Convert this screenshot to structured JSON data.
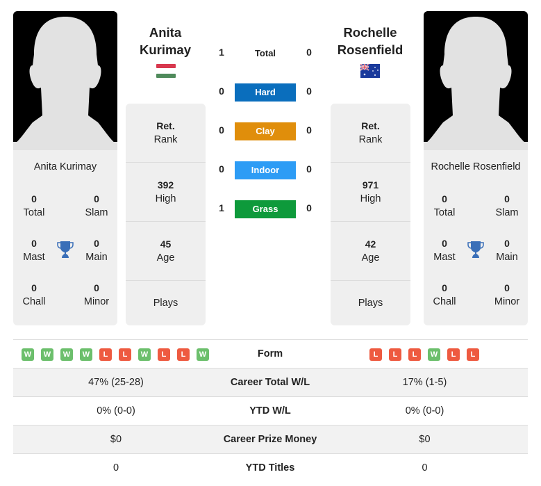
{
  "players": {
    "left": {
      "name_line1": "Anita",
      "name_line2": "Kurimay",
      "full_name": "Anita Kurimay",
      "country_flag": "hungary-flag",
      "titles": {
        "total": {
          "value": "0",
          "label": "Total"
        },
        "slam": {
          "value": "0",
          "label": "Slam"
        },
        "mast": {
          "value": "0",
          "label": "Mast"
        },
        "main": {
          "value": "0",
          "label": "Main"
        },
        "chall": {
          "value": "0",
          "label": "Chall"
        },
        "minor": {
          "value": "0",
          "label": "Minor"
        }
      },
      "rank": {
        "value": "Ret.",
        "label": "Rank"
      },
      "high": {
        "value": "392",
        "label": "High"
      },
      "age": {
        "value": "45",
        "label": "Age"
      },
      "plays": {
        "label": "Plays"
      }
    },
    "right": {
      "name_line1": "Rochelle",
      "name_line2": "Rosenfield",
      "full_name": "Rochelle Rosenfield",
      "country_flag": "australia-flag",
      "titles": {
        "total": {
          "value": "0",
          "label": "Total"
        },
        "slam": {
          "value": "0",
          "label": "Slam"
        },
        "mast": {
          "value": "0",
          "label": "Mast"
        },
        "main": {
          "value": "0",
          "label": "Main"
        },
        "chall": {
          "value": "0",
          "label": "Chall"
        },
        "minor": {
          "value": "0",
          "label": "Minor"
        }
      },
      "rank": {
        "value": "Ret.",
        "label": "Rank"
      },
      "high": {
        "value": "971",
        "label": "High"
      },
      "age": {
        "value": "42",
        "label": "Age"
      },
      "plays": {
        "label": "Plays"
      }
    }
  },
  "h2h": {
    "total": {
      "label": "Total",
      "left": "1",
      "right": "0"
    },
    "surfaces": [
      {
        "label": "Hard",
        "left": "0",
        "right": "0",
        "color": "#0a6ebd"
      },
      {
        "label": "Clay",
        "left": "0",
        "right": "0",
        "color": "#e08e0b"
      },
      {
        "label": "Indoor",
        "left": "0",
        "right": "0",
        "color": "#2d9cf5"
      },
      {
        "label": "Grass",
        "left": "1",
        "right": "0",
        "color": "#0e9a3b"
      }
    ]
  },
  "comparison": {
    "form": {
      "label": "Form",
      "left": [
        "W",
        "W",
        "W",
        "W",
        "L",
        "L",
        "W",
        "L",
        "L",
        "W"
      ],
      "right": [
        "L",
        "L",
        "L",
        "W",
        "L",
        "L"
      ]
    },
    "rows": [
      {
        "label": "Career Total W/L",
        "left": "47% (25-28)",
        "right": "17% (1-5)"
      },
      {
        "label": "YTD W/L",
        "left": "0% (0-0)",
        "right": "0% (0-0)"
      },
      {
        "label": "Career Prize Money",
        "left": "$0",
        "right": "$0"
      },
      {
        "label": "YTD Titles",
        "left": "0",
        "right": "0"
      }
    ]
  },
  "colors": {
    "win": "#6cbf6c",
    "loss": "#ee5a40",
    "trophy": "#3a6fb8"
  }
}
